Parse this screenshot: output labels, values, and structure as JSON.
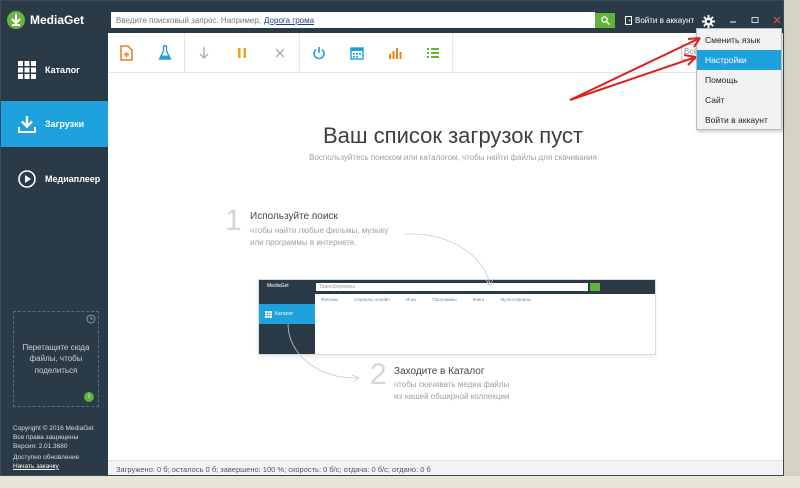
{
  "app": {
    "title": "MediaGet"
  },
  "sidebar": {
    "items": [
      {
        "label": "Каталог",
        "icon": "grid-icon"
      },
      {
        "label": "Загрузки",
        "icon": "download-icon"
      },
      {
        "label": "Медиаплеер",
        "icon": "play-icon"
      }
    ],
    "dropzone_text": "Перетащите сюда файлы, чтобы поделиться",
    "dropzone_badge": "i",
    "copyright": [
      "Copyright © 2016 MediaGet",
      "Все права защищены",
      "Версия: 2.01.3680"
    ],
    "update_status": "Доступно обновление",
    "update_link": "Начать закачку"
  },
  "header": {
    "search_placeholder": "Введите поисковый запрос. Например,",
    "search_example": "Дорога грома",
    "login_label": "Войти в аккаунт"
  },
  "toolbar": {
    "icons": [
      "add-file-icon",
      "flask-icon",
      "download-arrow-icon",
      "pause-icon",
      "close-icon",
      "power-icon",
      "calendar-icon",
      "bar-chart-icon",
      "list-icon"
    ]
  },
  "main": {
    "title": "Ваш список загрузок пуст",
    "subtitle": "Воспользуйтесь поиском или каталогом, чтобы найти файлы для скачивания",
    "steps": [
      {
        "number": "1",
        "title": "Используйте поиск",
        "text1": "чтобы найти любые фильмы, музыку",
        "text2": "или программы в интернете."
      },
      {
        "number": "2",
        "title": "Заходите в Каталог",
        "text1": "чтобы скачивать медиа файлы",
        "text2": "из нашей обширной коллекции"
      }
    ],
    "mini": {
      "app": "MediaGet",
      "search": "Трансформеры",
      "catalog": "Каталог",
      "tabs": [
        "Фильмы",
        "Сериалы онлайн",
        "Игры",
        "Программы",
        "Книги",
        "Мультсериалы"
      ]
    }
  },
  "menu": {
    "items": [
      "Сменить язык",
      "Настройки",
      "Помощь",
      "Сайт",
      "Войти в аккаунт"
    ],
    "highlighted": "Настройки"
  },
  "hidden_field_partial": "Всё",
  "status_bar": "Загружено: 0 б; осталось 0 б; завершено: 100 %; скорость: 0 б/с; отдача: 0 б/с; отдано: 0 б"
}
